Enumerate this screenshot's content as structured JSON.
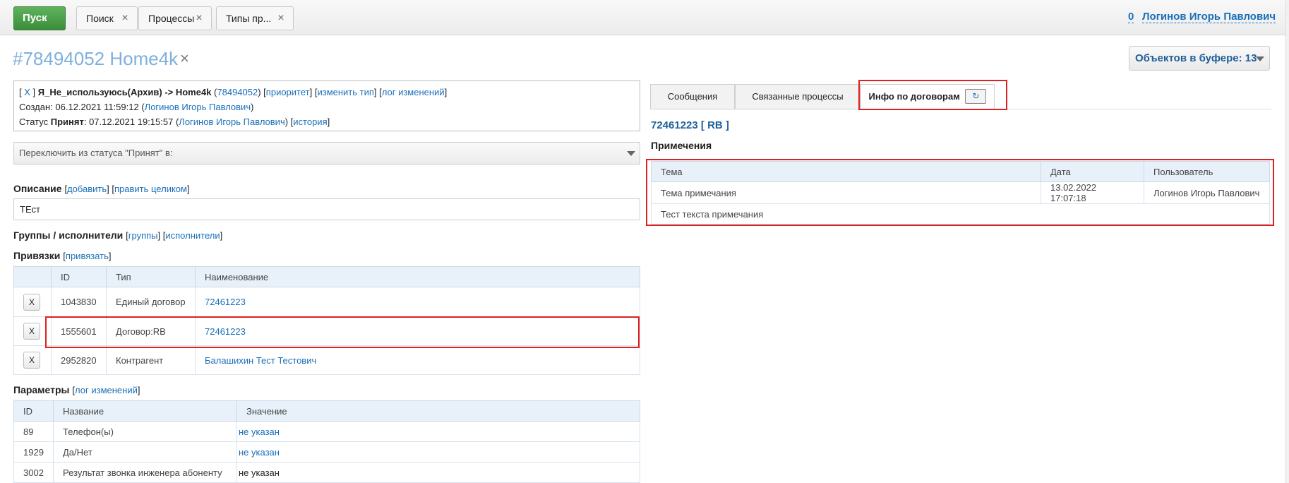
{
  "topbar": {
    "start_label": "Пуск",
    "tabs": [
      {
        "label": "Поиск"
      },
      {
        "label": "Процессы"
      },
      {
        "label": "Типы пр..."
      }
    ],
    "user_count": "0",
    "user_name": "Логинов Игорь Павлович"
  },
  "header": {
    "title": "#78494052 Home4k",
    "close": "×",
    "buffer_label": "Объектов в буфере: 13"
  },
  "info": {
    "bracket_open": "[",
    "x_link": "X",
    "bracket_close": "]",
    "path": "Я_Не_используюсь(Архив) -> Home4k",
    "id_link": "78494052",
    "priority_link": "приоритет",
    "change_type_link": "изменить тип",
    "changelog_link": "лог изменений",
    "created_label": "Создан:",
    "created_date": "06.12.2021 11:59:12",
    "created_user": "Логинов Игорь Павлович",
    "status_label": "Статус",
    "status_value": "Принят",
    "status_date": "07.12.2021 19:15:57",
    "status_user": "Логинов Игорь Павлович",
    "history_link": "история"
  },
  "status_select": {
    "placeholder": "Переключить из статуса \"Принят\" в:"
  },
  "description": {
    "title": "Описание",
    "add_link": "добавить",
    "edit_link": "править целиком",
    "value": "ТЕст"
  },
  "groups": {
    "title": "Группы / исполнители",
    "groups_link": "группы",
    "executors_link": "исполнители"
  },
  "links": {
    "title": "Привязки",
    "bind_link": "привязать",
    "columns": [
      "",
      "ID",
      "Тип",
      "Наименование"
    ],
    "rows": [
      {
        "remove": "X",
        "id": "1043830",
        "type": "Единый договор",
        "name": "72461223"
      },
      {
        "remove": "X",
        "id": "1555601",
        "type": "Договор:RB",
        "name": "72461223"
      },
      {
        "remove": "X",
        "id": "2952820",
        "type": "Контрагент",
        "name": "Балашихин Тест Тестович"
      }
    ]
  },
  "params": {
    "title": "Параметры",
    "log_link": "лог изменений",
    "columns": [
      "ID",
      "Название",
      "Значение"
    ],
    "rows": [
      {
        "id": "89",
        "name": "Телефон(ы)",
        "value": "не указан"
      },
      {
        "id": "1929",
        "name": "Да/Нет",
        "value": "не указан"
      },
      {
        "id": "3002",
        "name": "Результат звонка инженера абоненту",
        "value": "не указан"
      }
    ]
  },
  "right": {
    "tabs": [
      {
        "label": "Сообщения"
      },
      {
        "label": "Связанные процессы"
      },
      {
        "label": "Инфо по договорам"
      }
    ],
    "refresh_icon": "refresh-icon",
    "contract": "72461223 [ RB ]",
    "notes_title": "Примечения",
    "notes_columns": [
      "Тема",
      "Дата",
      "Пользователь"
    ],
    "notes_row": {
      "topic": "Тема примечания",
      "date": "13.02.2022 17:07:18",
      "user": "Логинов Игорь Павлович"
    },
    "notes_text": "Тест текста примечания"
  },
  "colors": {
    "accent": "#1a6fb8",
    "start_green": "#3c8d3a",
    "highlight_red": "#e02020",
    "table_header": "#e8f1fa"
  }
}
